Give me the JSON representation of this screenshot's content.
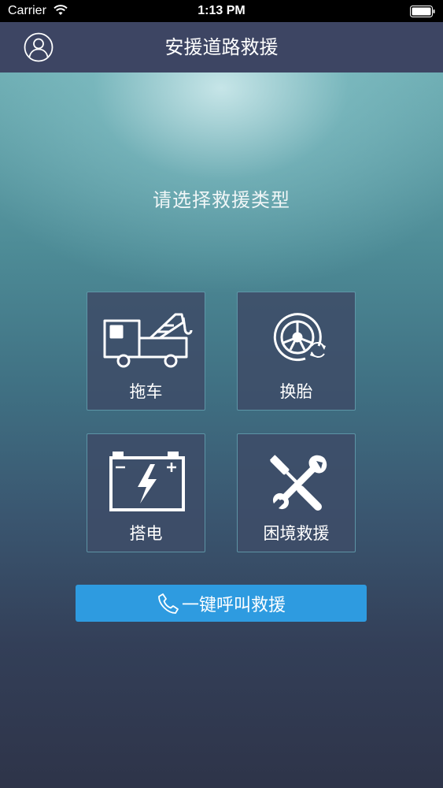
{
  "status_bar": {
    "carrier": "Carrier",
    "time": "1:13 PM"
  },
  "navbar": {
    "title": "安援道路救援",
    "avatar_icon": "user-profile-icon"
  },
  "main": {
    "prompt": "请选择救援类型",
    "options": [
      {
        "label": "拖车",
        "icon": "tow-truck-icon"
      },
      {
        "label": "换胎",
        "icon": "tire-change-icon"
      },
      {
        "label": "搭电",
        "icon": "car-battery-icon"
      },
      {
        "label": "困境救援",
        "icon": "wrench-screwdriver-icon"
      }
    ],
    "call_button": {
      "label": "一键呼叫救援",
      "icon": "phone-icon"
    }
  },
  "colors": {
    "navbar": "#3d4563",
    "tile_bg": "#3e4c68",
    "tile_border": "#78cdd7",
    "call_button": "#2e9be0"
  }
}
